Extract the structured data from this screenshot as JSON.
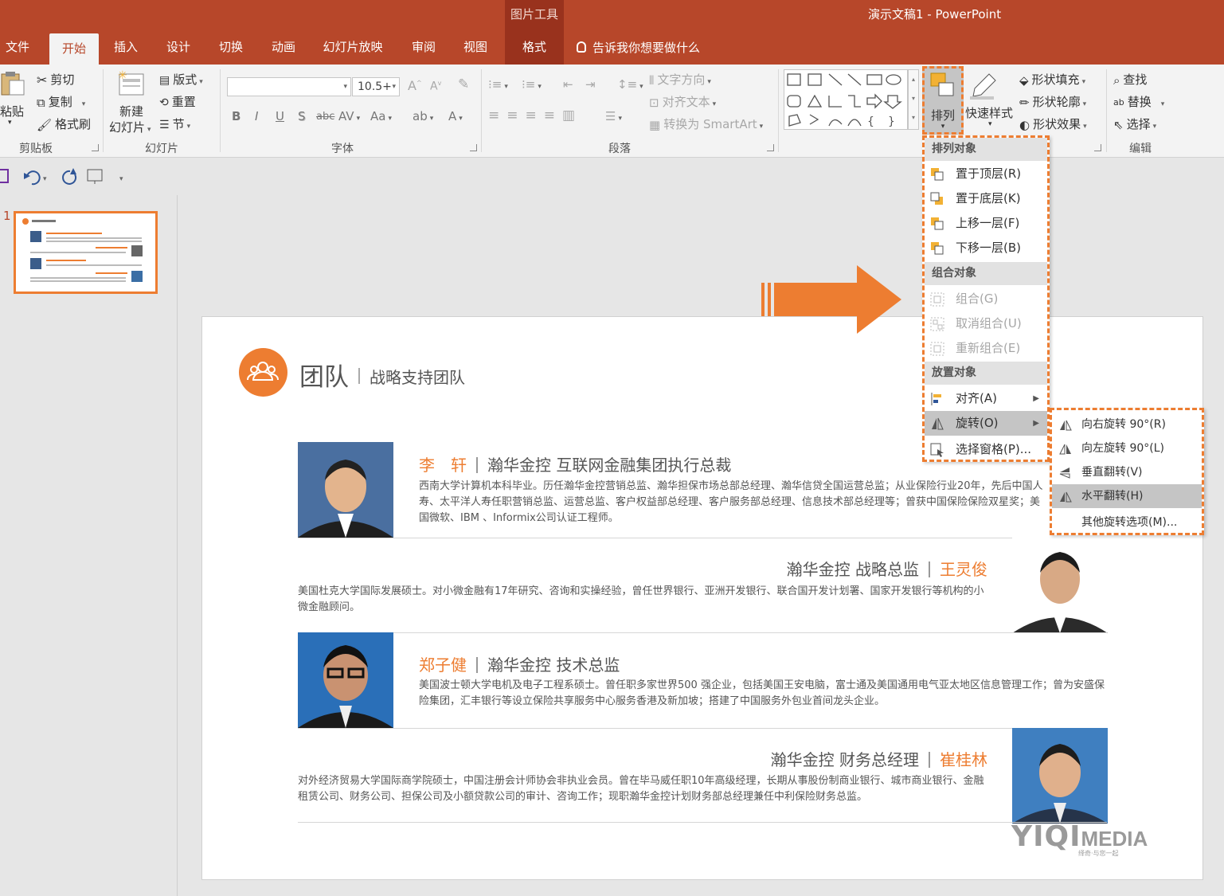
{
  "titlebar": {
    "context_tools": "图片工具",
    "doc_title": "演示文稿1 - PowerPoint"
  },
  "tabs": [
    "文件",
    "开始",
    "插入",
    "设计",
    "切换",
    "动画",
    "幻灯片放映",
    "审阅",
    "视图",
    "格式"
  ],
  "tell_me": "告诉我你想要做什么",
  "ribbon": {
    "clipboard": {
      "paste": "粘贴",
      "cut": "剪切",
      "copy": "复制",
      "format_painter": "格式刷",
      "label": "剪贴板"
    },
    "slides": {
      "new_slide_1": "新建",
      "new_slide_2": "幻灯片",
      "layout": "版式",
      "reset": "重置",
      "section": "节",
      "label": "幻灯片"
    },
    "font": {
      "size": "10.5+",
      "bold": "B",
      "italic": "I",
      "underline": "U",
      "shadow": "S",
      "strike": "abc",
      "spacing": "AV",
      "case": "Aa",
      "font_color": "A",
      "label": "字体"
    },
    "paragraph": {
      "text_direction": "文字方向",
      "align_text": "对齐文本",
      "smartart": "转换为 SmartArt",
      "label": "段落"
    },
    "drawing": {
      "arrange": "排列",
      "quick_styles": "快速样式",
      "shape_fill": "形状填充",
      "shape_outline": "形状轮廓",
      "shape_effects": "形状效果"
    },
    "editing": {
      "find": "查找",
      "replace": "替换",
      "select": "选择",
      "label": "编辑"
    }
  },
  "thumbnail": {
    "number": "1"
  },
  "slide": {
    "title": "团队",
    "subtitle": "战略支持团队",
    "people": [
      {
        "name": "李　轩",
        "role": "瀚华金控 互联网金融集团执行总裁",
        "bio": "西南大学计算机本科毕业。历任瀚华金控营销总监、瀚华担保市场总部总经理、瀚华信贷全国运营总监；从业保险行业20年，先后中国人寿、太平洋人寿任职营销总监、运营总监、客户权益部总经理、客户服务部总经理、信息技术部总经理等；曾获中国保险保险双星奖；美国微软、IBM 、Informix公司认证工程师。"
      },
      {
        "name": "王灵俊",
        "role": "瀚华金控 战略总监",
        "bio": "美国杜克大学国际发展硕士。对小微金融有17年研究、咨询和实操经验，曾任世界银行、亚洲开发银行、联合国开发计划署、国家开发银行等机构的小微金融顾问。"
      },
      {
        "name": "郑子健",
        "role": "瀚华金控 技术总监",
        "bio": "美国波士顿大学电机及电子工程系硕士。曾任职多家世界500 强企业，包括美国王安电脑，富士通及美国通用电气亚太地区信息管理工作；曾为安盛保险集团，汇丰银行等设立保险共享服务中心服务香港及新加坡；搭建了中国服务外包业首间龙头企业。"
      },
      {
        "name": "崔桂林",
        "role": "瀚华金控 财务总经理",
        "bio": "对外经济贸易大学国际商学院硕士，中国注册会计师协会非执业会员。曾在毕马威任职10年高级经理，长期从事股份制商业银行、城市商业银行、金融租赁公司、财务公司、担保公司及小额贷款公司的审计、咨询工作；现职瀚华金控计划财务部总经理兼任中利保险财务总监。"
      }
    ]
  },
  "arrange_menu": {
    "sections": [
      "排列对象",
      "组合对象",
      "放置对象"
    ],
    "items": [
      "置于顶层(R)",
      "置于底层(K)",
      "上移一层(F)",
      "下移一层(B)",
      "组合(G)",
      "取消组合(U)",
      "重新组合(E)",
      "对齐(A)",
      "旋转(O)",
      "选择窗格(P)..."
    ]
  },
  "rotate_submenu": {
    "items": [
      "向右旋转 90°(R)",
      "向左旋转 90°(L)",
      "垂直翻转(V)",
      "水平翻转(H)",
      "其他旋转选项(M)..."
    ]
  },
  "watermark": {
    "brand": "YIQI",
    "media": "MEDIA",
    "tagline": "绎奇·与您一起"
  },
  "colors": {
    "accent": "#b7472a",
    "orange": "#ed7d31"
  }
}
